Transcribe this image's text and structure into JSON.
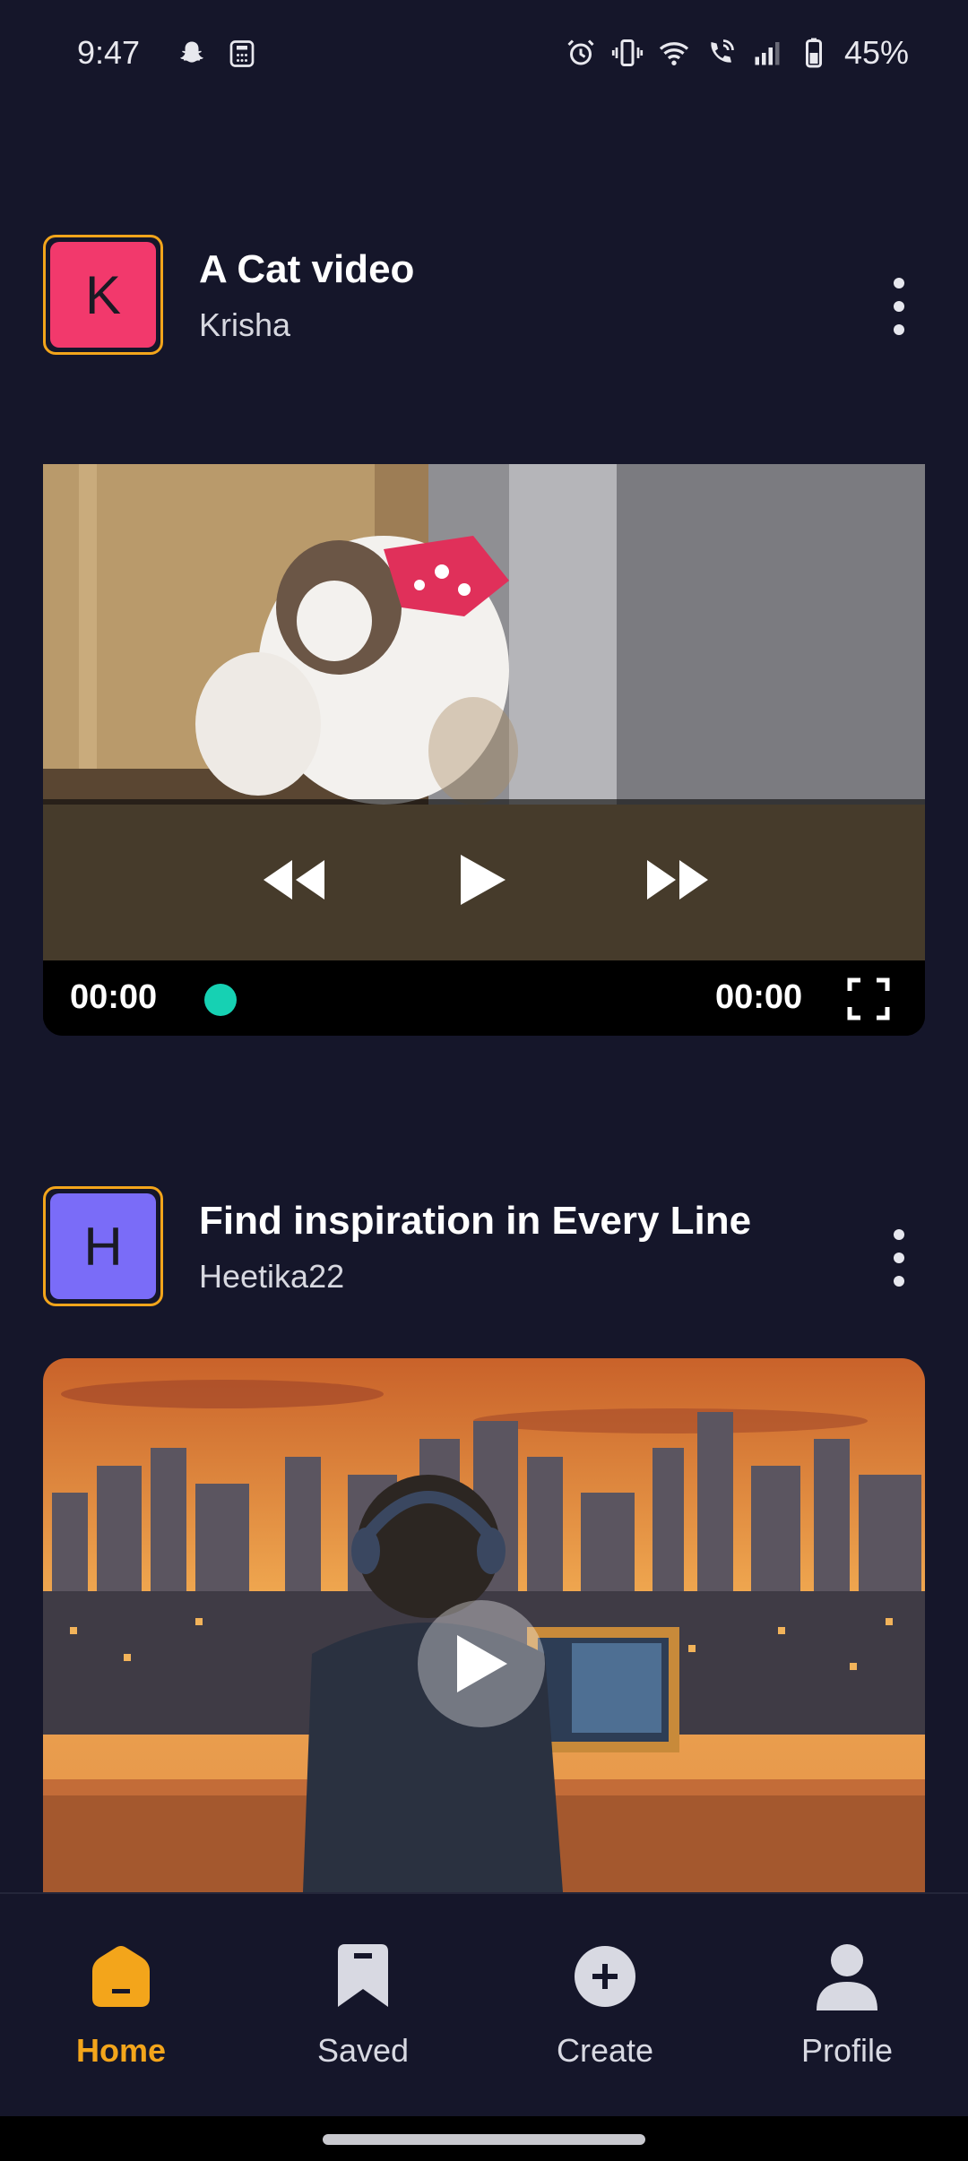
{
  "status_bar": {
    "time": "9:47",
    "battery": "45%",
    "icons": [
      "snapchat-icon",
      "calculator-icon",
      "alarm-icon",
      "vibrate-icon",
      "wifi-icon",
      "wifi-calling-icon",
      "signal-icon",
      "battery-icon"
    ]
  },
  "posts": [
    {
      "title": "A Cat video",
      "author": "Krisha",
      "avatar_letter": "K",
      "avatar_color": "#f2396c",
      "type": "video",
      "player": {
        "current_time": "00:00",
        "end_time": "00:00",
        "progress": 0
      }
    },
    {
      "title": "Find inspiration in Every Line",
      "author": "Heetika22",
      "avatar_letter": "H",
      "avatar_color": "#7a6cf8",
      "type": "image"
    }
  ],
  "bottom_nav": {
    "items": [
      {
        "label": "Home",
        "icon": "home-icon",
        "active": true
      },
      {
        "label": "Saved",
        "icon": "bookmark-icon",
        "active": false
      },
      {
        "label": "Create",
        "icon": "plus-circle-icon",
        "active": false
      },
      {
        "label": "Profile",
        "icon": "person-icon",
        "active": false
      }
    ]
  },
  "colors": {
    "background": "#15162a",
    "accent": "#f3a51b",
    "scrubber": "#16d1b3"
  }
}
